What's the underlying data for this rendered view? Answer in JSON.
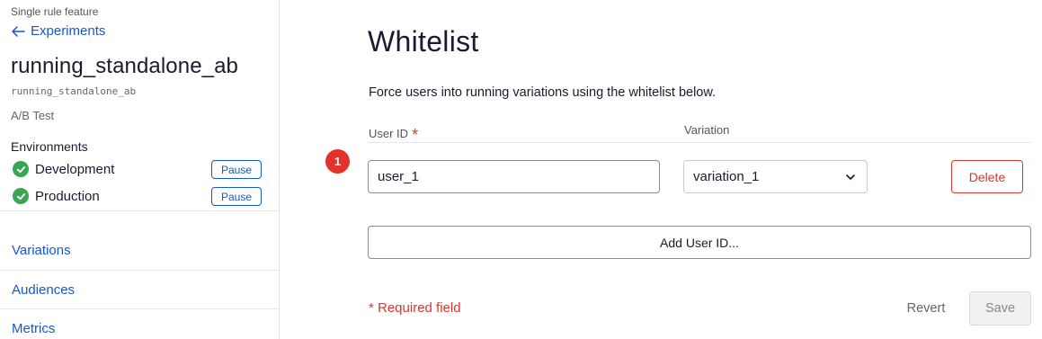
{
  "sidebar": {
    "feature_kind": "Single rule feature",
    "back_label": "Experiments",
    "experiment_name": "running_standalone_ab",
    "experiment_key": "running_standalone_ab",
    "experiment_type": "A/B Test",
    "environments_heading": "Environments",
    "environments": [
      {
        "name": "Development",
        "status_icon": "check-circle-icon",
        "action_label": "Pause"
      },
      {
        "name": "Production",
        "status_icon": "check-circle-icon",
        "action_label": "Pause"
      }
    ],
    "nav": [
      {
        "label": "Variations"
      },
      {
        "label": "Audiences"
      },
      {
        "label": "Metrics"
      }
    ]
  },
  "main": {
    "title": "Whitelist",
    "description": "Force users into running variations using the whitelist below.",
    "columns": {
      "user_id": "User ID",
      "required_mark": "*",
      "variation": "Variation"
    },
    "rows": [
      {
        "badge": "1",
        "user_id": "user_1",
        "variation": "variation_1",
        "delete_label": "Delete"
      }
    ],
    "add_label": "Add User ID...",
    "required_note": "* Required field",
    "revert_label": "Revert",
    "save_label": "Save"
  },
  "colors": {
    "link_blue": "#1457d6",
    "success_green": "#3aa552",
    "danger_red": "#d6372f",
    "badge_red": "#e3312b"
  }
}
